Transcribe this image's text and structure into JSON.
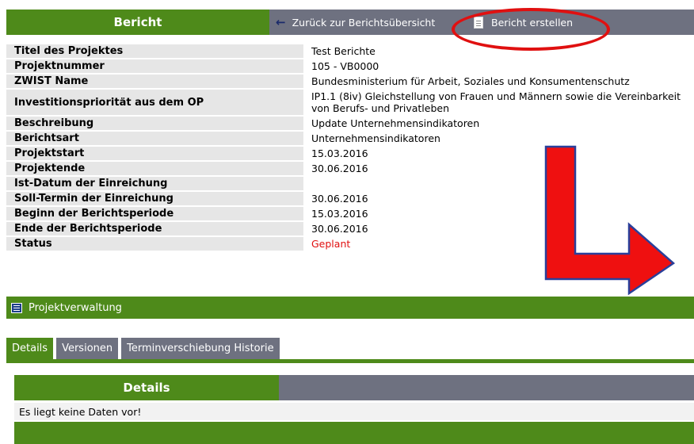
{
  "header": {
    "title": "Bericht",
    "back_label": "Zurück zur Berichtsübersicht",
    "create_label": "Bericht erstellen"
  },
  "info_rows": [
    {
      "label": "Titel des Projektes",
      "value": "Test Berichte"
    },
    {
      "label": "Projektnummer",
      "value": "105 - VB0000"
    },
    {
      "label": "ZWIST Name",
      "value": "Bundesministerium für Arbeit, Soziales und Konsumentenschutz"
    },
    {
      "label": "Investitionspriorität aus dem OP",
      "value": "IP1.1 (8iv) Gleichstellung von Frauen und Männern sowie die Vereinbarkeit von Berufs- und Privatleben"
    },
    {
      "label": "Beschreibung",
      "value": "Update Unternehmensindikatoren"
    },
    {
      "label": "Berichtsart",
      "value": "Unternehmensindikatoren"
    },
    {
      "label": "Projektstart",
      "value": "15.03.2016"
    },
    {
      "label": "Projektende",
      "value": "30.06.2016"
    },
    {
      "label": "Ist-Datum der Einreichung",
      "value": ""
    },
    {
      "label": "Soll-Termin der Einreichung",
      "value": "30.06.2016"
    },
    {
      "label": "Beginn der Berichtsperiode",
      "value": "15.03.2016"
    },
    {
      "label": "Ende der Berichtsperiode",
      "value": "30.06.2016"
    },
    {
      "label": "Status",
      "value": "Geplant"
    }
  ],
  "colors": {
    "status": "#e01010",
    "green": "#4e8a1a",
    "gray": "#6e7180",
    "annotation": "#e01010"
  },
  "projektverwaltung": {
    "label": "Projektverwaltung",
    "icon": "table-icon"
  },
  "tabs": [
    {
      "label": "Details",
      "active": true
    },
    {
      "label": "Versionen",
      "active": false
    },
    {
      "label": "Terminverschiebung Historie",
      "active": false
    }
  ],
  "details": {
    "title": "Details",
    "empty_message": "Es liegt keine Daten vor!"
  }
}
